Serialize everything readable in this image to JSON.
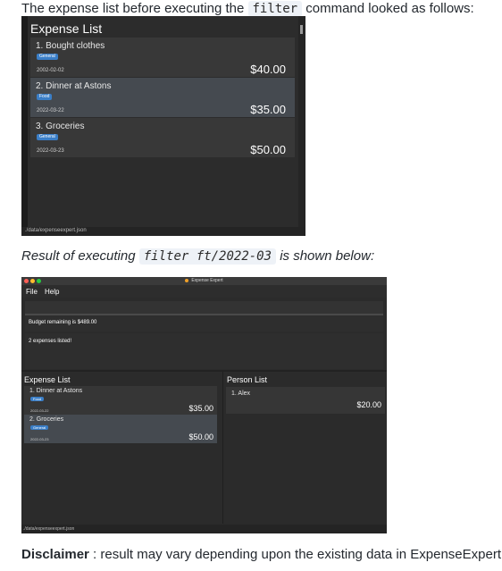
{
  "intro": {
    "before": "The expense list before executing the",
    "code": "filter",
    "after": "command looked as follows:"
  },
  "shot1": {
    "title": "Expense List",
    "expenses": [
      {
        "name": "1.  Bought clothes",
        "tag": "General",
        "date": "2002-02-02",
        "amount": "$40.00"
      },
      {
        "name": "2.  Dinner at Astons",
        "tag": "Food",
        "date": "2022-03-22",
        "amount": "$35.00"
      },
      {
        "name": "3.  Groceries",
        "tag": "General",
        "date": "2022-03-23",
        "amount": "$50.00"
      }
    ],
    "footer": "./data/expenseexpert.json"
  },
  "result_line": {
    "before": "Result of executing",
    "code": "filter ft/2022-03",
    "after": "is shown below:"
  },
  "shot2": {
    "window_title": "Expense Expert",
    "menu": {
      "file": "File",
      "help": "Help"
    },
    "budget": "Budget remaining is $489.00",
    "status": "2 expenses listed!",
    "expense_title": "Expense List",
    "person_title": "Person List",
    "expenses": [
      {
        "name": "1.  Dinner at Astons",
        "tag": "Food",
        "date": "2022-03-22",
        "amount": "$35.00"
      },
      {
        "name": "2.  Groceries",
        "tag": "General",
        "date": "2022-03-23",
        "amount": "$50.00"
      }
    ],
    "persons": [
      {
        "name": "1.  Alex",
        "amount": "$20.00"
      }
    ],
    "footer": "./data/expenseexpert.json"
  },
  "disclaimer": {
    "label": "Disclaimer",
    "text": " : result may vary depending upon the existing data in ExpenseExpert."
  },
  "colors": {
    "tag_blue": "#3a7ec7",
    "selected_card": "#454a50",
    "card_alt": "#383838"
  }
}
